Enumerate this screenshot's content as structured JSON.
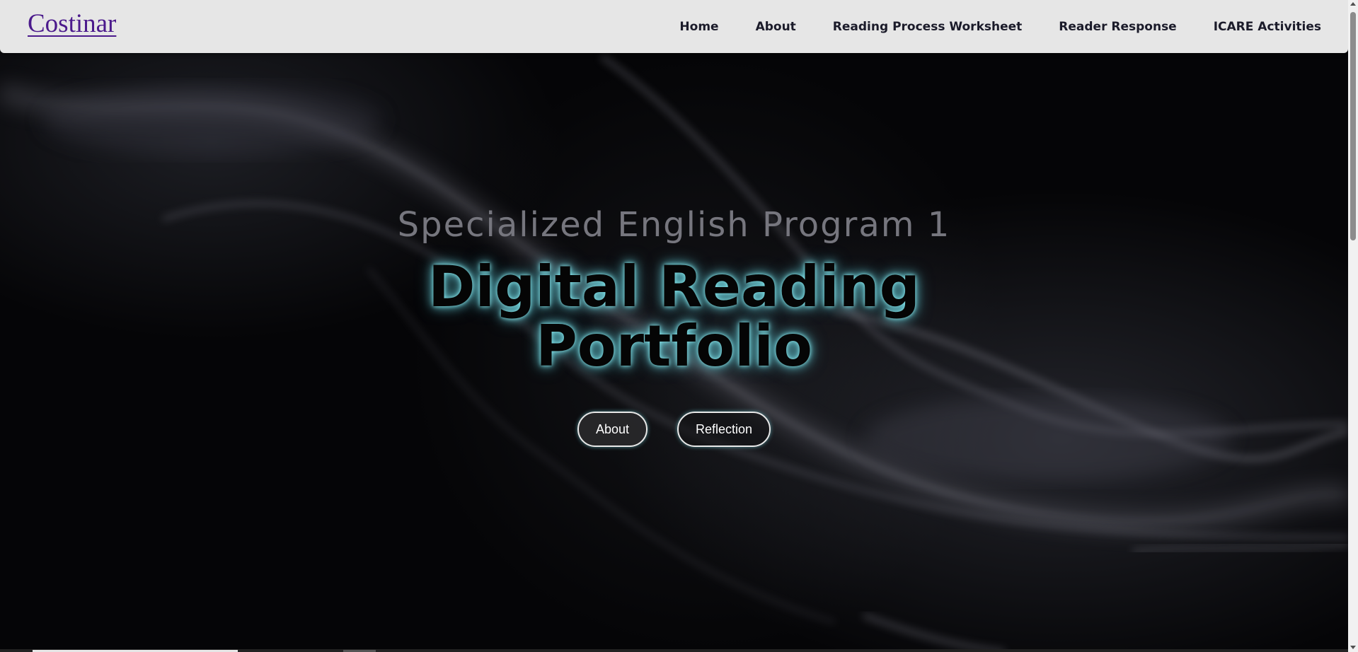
{
  "navbar": {
    "brand": "Costinar",
    "links": [
      {
        "label": "Home"
      },
      {
        "label": "About"
      },
      {
        "label": "Reading Process Worksheet"
      },
      {
        "label": "Reader Response"
      },
      {
        "label": "ICARE Activities"
      }
    ]
  },
  "hero": {
    "subtitle": "Specialized English Program 1",
    "title_line1": "Digital Reading",
    "title_line2": "Portfolio",
    "buttons": [
      {
        "label": "About"
      },
      {
        "label": "Reflection"
      }
    ]
  },
  "colors": {
    "navbar_bg": "#e6e6e6",
    "brand": "#4b1a8c",
    "title_glow": "#8cebf0",
    "subtitle": "#76767e",
    "background": "#050507"
  }
}
